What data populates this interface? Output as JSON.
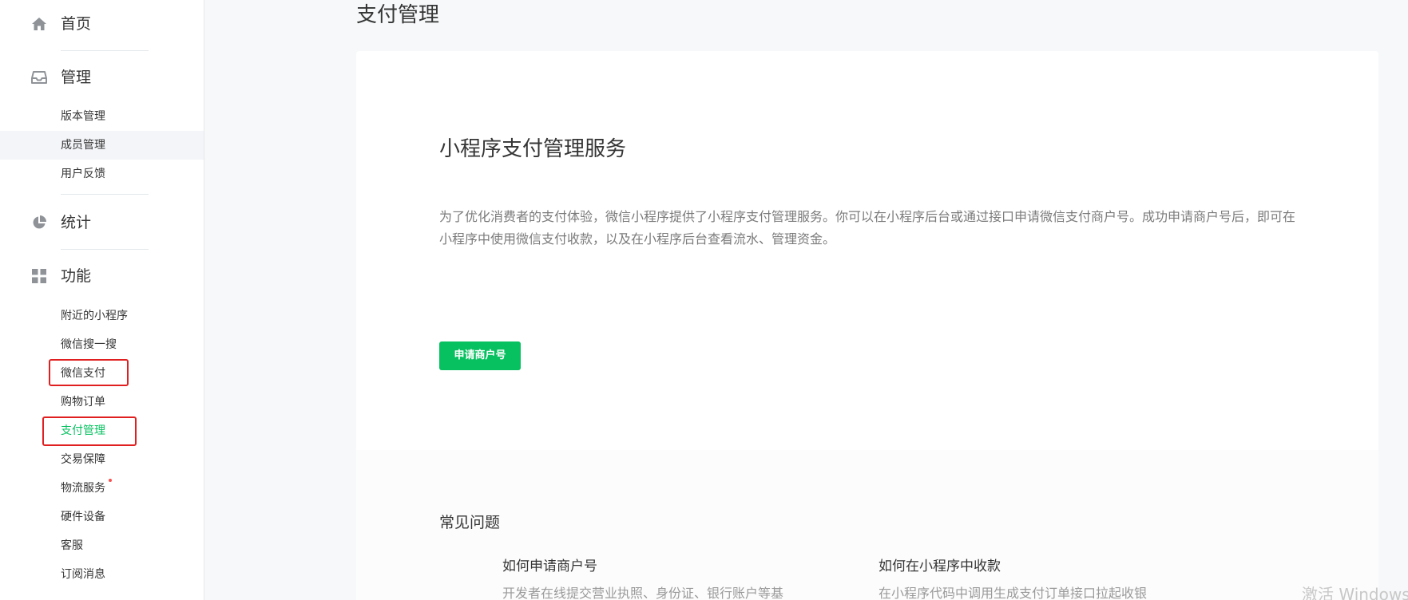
{
  "sidebar": {
    "home": {
      "label": "首页",
      "icon": "home-icon"
    },
    "manage": {
      "label": "管理",
      "icon": "inbox-icon",
      "items": [
        {
          "label": "版本管理"
        },
        {
          "label": "成员管理"
        },
        {
          "label": "用户反馈"
        }
      ]
    },
    "stats": {
      "label": "统计",
      "icon": "pie-chart-icon"
    },
    "features": {
      "label": "功能",
      "icon": "grid-icon",
      "items": [
        {
          "label": "附近的小程序"
        },
        {
          "label": "微信搜一搜"
        },
        {
          "label": "微信支付"
        },
        {
          "label": "购物订单"
        },
        {
          "label": "支付管理"
        },
        {
          "label": "交易保障"
        },
        {
          "label": "物流服务"
        },
        {
          "label": "硬件设备"
        },
        {
          "label": "客服"
        },
        {
          "label": "订阅消息"
        }
      ]
    }
  },
  "main": {
    "page_title": "支付管理",
    "service_title": "小程序支付管理服务",
    "service_desc": "为了优化消费者的支付体验，微信小程序提供了小程序支付管理服务。你可以在小程序后台或通过接口申请微信支付商户号。成功申请商户号后，即可在小程序中使用微信支付收款，以及在小程序后台查看流水、管理资金。",
    "apply_button": "申请商户号",
    "faq": {
      "title": "常见问题",
      "items": [
        {
          "question": "如何申请商户号",
          "answer": "开发者在线提交营业执照、身份证、银行账户等基"
        },
        {
          "question": "如何在小程序中收款",
          "answer": "在小程序代码中调用生成支付订单接口拉起收银"
        }
      ]
    }
  },
  "watermark": "激活 Windows",
  "colors": {
    "accent": "#07c160",
    "highlight": "#e02020",
    "dot": "#fa5151"
  }
}
